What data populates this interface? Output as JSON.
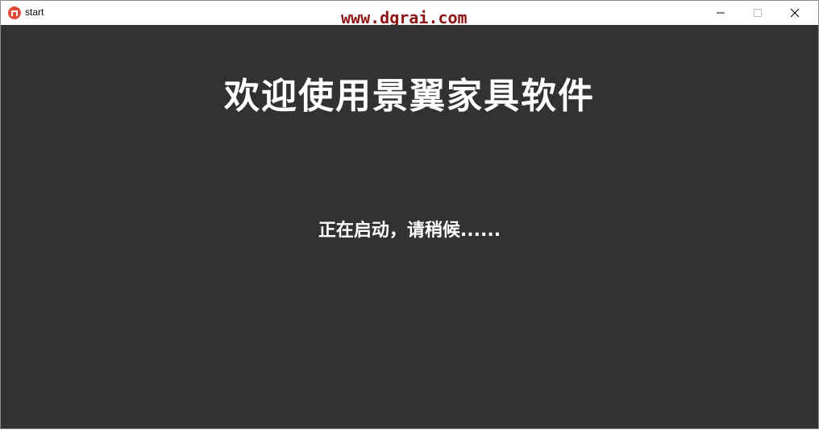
{
  "window": {
    "title": "start",
    "icon": "app-logo-icon"
  },
  "watermark": "www.dgrai.com",
  "controls": {
    "minimize_icon": "minimize-icon",
    "maximize_icon": "maximize-icon",
    "close_icon": "close-icon"
  },
  "splash": {
    "welcome_text": "欢迎使用景翼家具软件",
    "loading_text": "正在启动，请稍候......"
  },
  "colors": {
    "background": "#323232",
    "text": "#ffffff",
    "watermark": "#8c1414",
    "app_icon": "#e04a3a"
  }
}
